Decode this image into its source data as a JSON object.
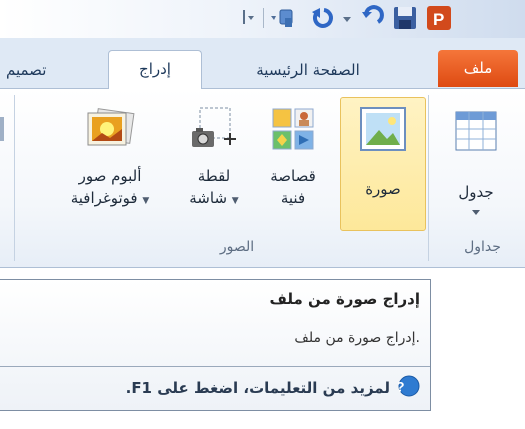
{
  "tabs": {
    "file": "ملف",
    "home": "الصفحة الرئيسية",
    "insert": "إدراج",
    "design": "تصميم"
  },
  "ribbon": {
    "table_label": "جدول",
    "picture_label": "صورة",
    "clipart_label_1": "قصاصة",
    "clipart_label_2": "فنية",
    "screenshot_label_1": "لقطة",
    "screenshot_label_2": "شاشة",
    "album_label_1": "ألبوم صور",
    "album_label_2": "فوتوغرافية",
    "group_tables": "جداول",
    "group_images": "الصور"
  },
  "tooltip": {
    "title": "إدراج صورة من ملف",
    "body": "إدراج صورة من ملف.",
    "help": "لمزيد من التعليمات، اضغط على F1."
  },
  "icons": [
    "undo-icon",
    "redo-icon",
    "save-icon",
    "powerpoint-logo-icon",
    "table-icon",
    "picture-icon",
    "clipart-icon",
    "screenshot-icon",
    "photo-album-icon",
    "help-icon"
  ],
  "colors": {
    "file_tab": "#e35a1f",
    "selected_button": "#fde89a",
    "ribbon_bg": "#f4f7fb",
    "tab_row_bg": "#dfe9f5"
  }
}
